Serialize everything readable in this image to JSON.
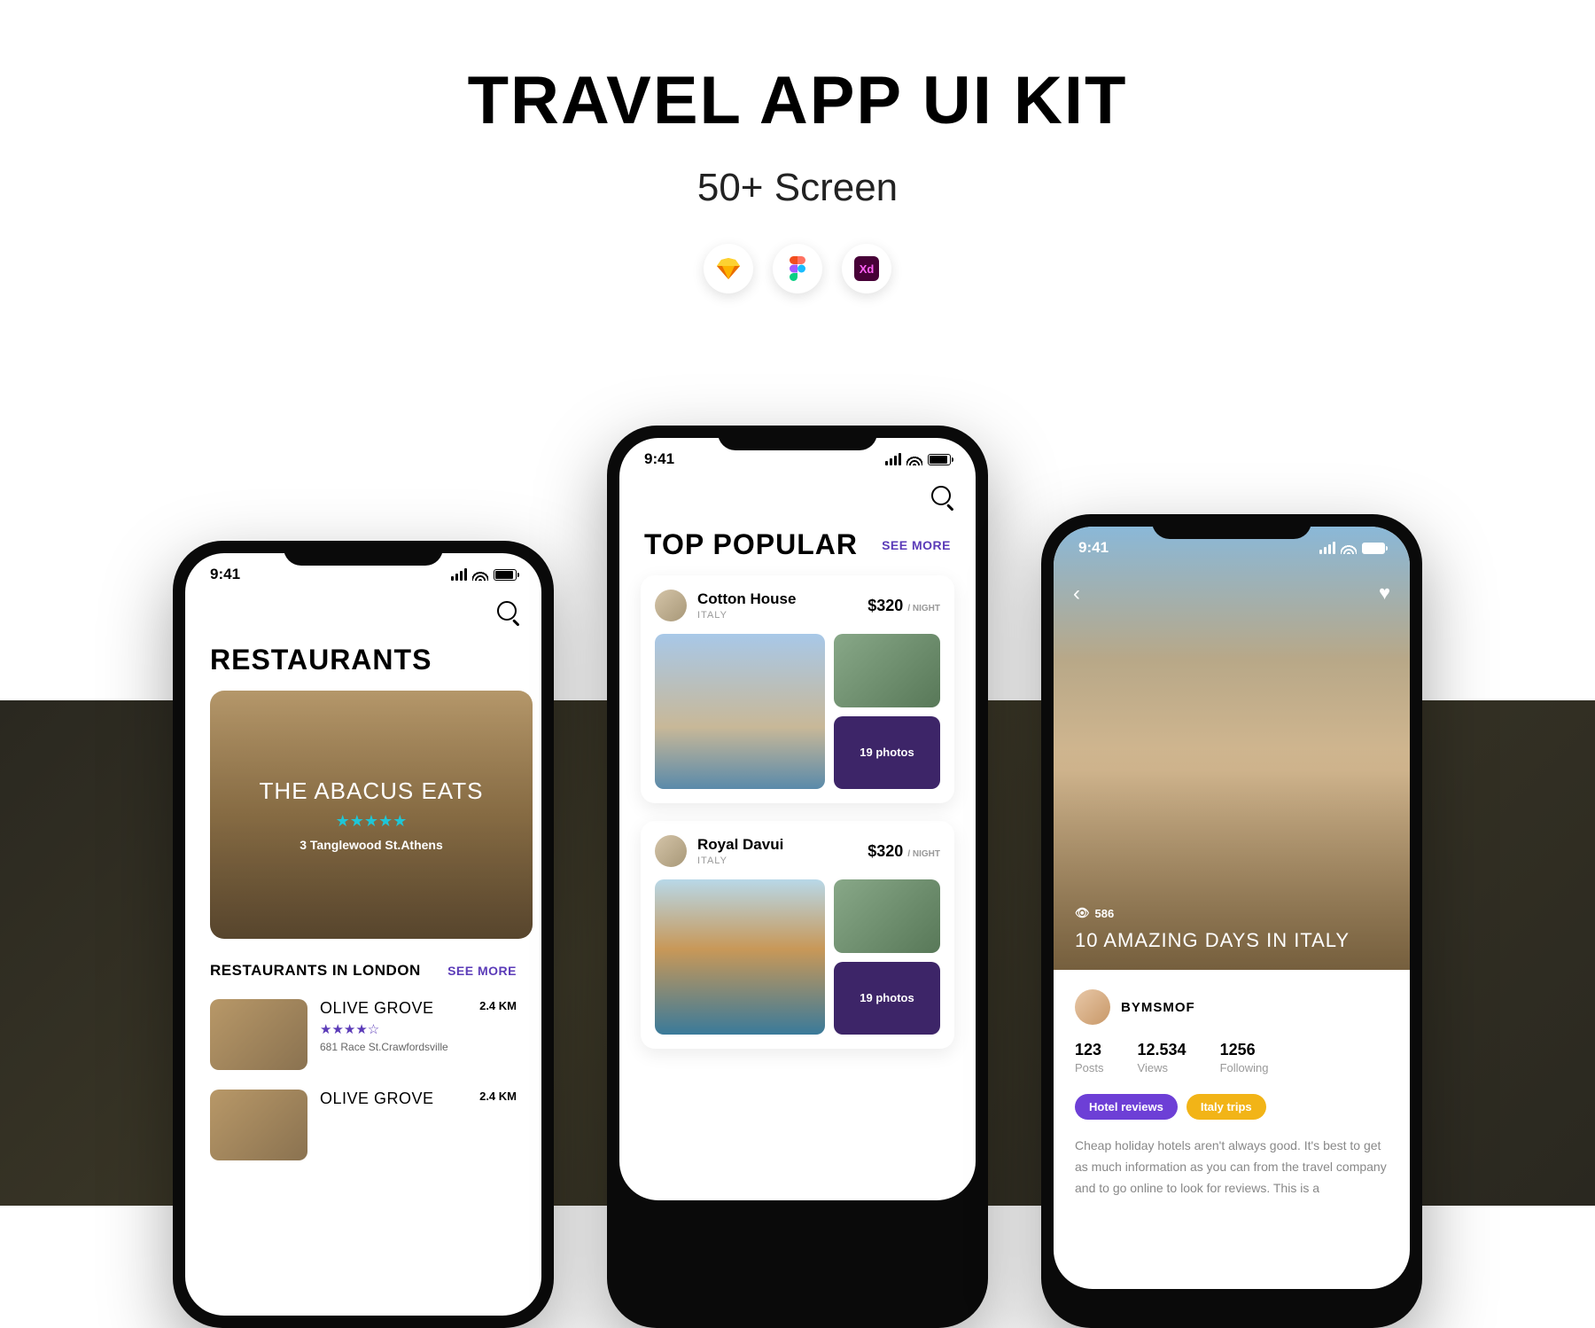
{
  "hero": {
    "title": "TRAVEL APP UI KIT",
    "subtitle": "50+ Screen",
    "tools": [
      "sketch",
      "figma",
      "xd"
    ]
  },
  "status_time": "9:41",
  "phone1": {
    "section_title": "RESTAURANTS",
    "featured": {
      "name": "THE ABACUS EATS",
      "address": "3 Tanglewood St.Athens"
    },
    "list_title": "RESTAURANTS IN LONDON",
    "see_more": "SEE MORE",
    "items": [
      {
        "name": "OLIVE GROVE",
        "distance": "2.4 KM",
        "address": "681 Race St.Crawfordsville"
      },
      {
        "name": "OLIVE GROVE",
        "distance": "2.4 KM",
        "address": ""
      }
    ]
  },
  "phone2": {
    "section_title": "TOP POPULAR",
    "see_more": "SEE MORE",
    "cards": [
      {
        "name": "Cotton House",
        "location": "ITALY",
        "price": "$320",
        "unit": "/ NIGHT",
        "more": "19 photos"
      },
      {
        "name": "Royal Davui",
        "location": "ITALY",
        "price": "$320",
        "unit": "/ NIGHT",
        "more": "19 photos"
      }
    ]
  },
  "phone3": {
    "views": "586",
    "title": "10 AMAZING DAYS IN ITALY",
    "author": "BYMSMOF",
    "stats": [
      {
        "num": "123",
        "label": "Posts"
      },
      {
        "num": "12.534",
        "label": "Views"
      },
      {
        "num": "1256",
        "label": "Following"
      }
    ],
    "tags": [
      "Hotel reviews",
      "Italy trips"
    ],
    "body": "Cheap holiday hotels aren't always good. It's best to get as much information as you can from the travel company and to go online to look for reviews. This is a"
  }
}
